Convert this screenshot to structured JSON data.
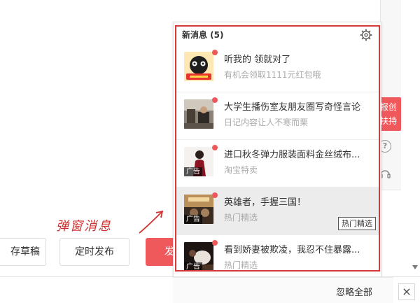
{
  "side": {
    "badge_line1": "报创",
    "badge_line2": "扶持",
    "help_icon": "question-circle-icon",
    "service_icon": "headset-icon"
  },
  "buttons": {
    "save_draft": "存草稿",
    "schedule": "定时发布",
    "publish": "发"
  },
  "annotation": {
    "label": "弹窗消息",
    "color": "#d0302f"
  },
  "popup": {
    "title": "新消息 (5)",
    "settings_icon": "gear-icon",
    "ignore_all": "忽略全部",
    "tooltip": "热门精选",
    "messages": [
      {
        "title": "听我的 领就对了",
        "subtitle": "有机会领取1111元红包哦",
        "ad": "",
        "unread": true
      },
      {
        "title": "大学生播伤室友朋友圈写奇怪言论",
        "subtitle": "日记内容让人不寒而栗",
        "ad": "",
        "unread": true
      },
      {
        "title": "进口秋冬弹力服装面料金丝绒布...",
        "subtitle": "淘宝特卖",
        "ad": "广告",
        "unread": true
      },
      {
        "title": "英雄者，手握三国！",
        "subtitle": "热门精选",
        "ad": "广告",
        "unread": true
      },
      {
        "title": "看到娇妻被欺凌，我忍不住暴露...",
        "subtitle": "热门精选",
        "ad": "广告",
        "unread": true
      }
    ]
  },
  "close_label": "×",
  "colors": {
    "accent": "#f0595c",
    "highlight_border": "#d9383a"
  }
}
